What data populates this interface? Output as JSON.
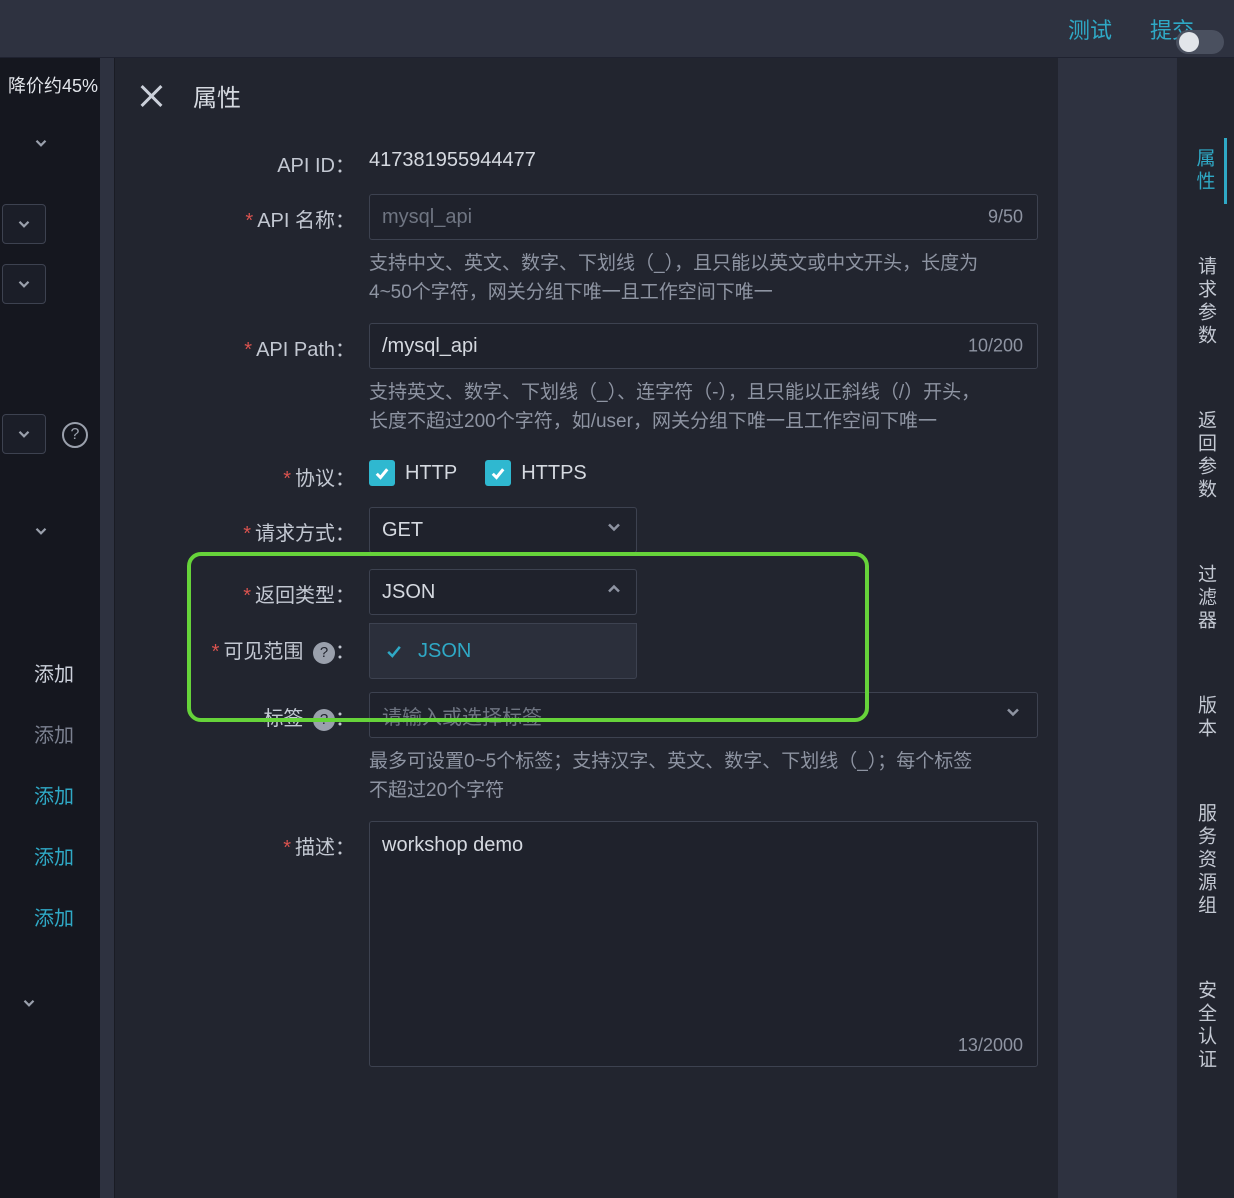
{
  "topbar": {
    "test_label": "测试",
    "submit_label": "提交"
  },
  "leftcol": {
    "promo": "降价约45%",
    "add_header": "添加",
    "add_muted": "添加",
    "add_link1": "添加",
    "add_link2": "添加",
    "add_link3": "添加"
  },
  "panel": {
    "title": "属性"
  },
  "form": {
    "api_id_label": "API ID：",
    "api_id_value": "417381955944477",
    "api_name_label": "API 名称：",
    "api_name_placeholder": "mysql_api",
    "api_name_counter": "9/50",
    "api_name_hint": "支持中文、英文、数字、下划线（_），且只能以英文或中文开头，长度为4~50个字符，网关分组下唯一且工作空间下唯一",
    "api_path_label": "API Path：",
    "api_path_value": "/mysql_api",
    "api_path_counter": "10/200",
    "api_path_hint": "支持英文、数字、下划线（_）、连字符（-），且只能以正斜线（/）开头，长度不超过200个字符，如/user，网关分组下唯一且工作空间下唯一",
    "protocol_label": "协议：",
    "protocol_http": "HTTP",
    "protocol_https": "HTTPS",
    "method_label": "请求方式：",
    "method_value": "GET",
    "return_type_label": "返回类型：",
    "return_type_value": "JSON",
    "return_type_option": "JSON",
    "visible_label": "可见范围",
    "tags_label": "标签",
    "tags_placeholder": "请输入或选择标签",
    "tags_hint": "最多可设置0~5个标签；支持汉字、英文、数字、下划线（_）；每个标签不超过20个字符",
    "desc_label": "描述：",
    "desc_value": "workshop demo",
    "desc_counter": "13/2000"
  },
  "rtabs": {
    "t1": "属性",
    "t2": "请求参数",
    "t3": "返回参数",
    "t4": "过滤器",
    "t5": "版本",
    "t6": "服务资源组",
    "t7": "安全认证"
  }
}
